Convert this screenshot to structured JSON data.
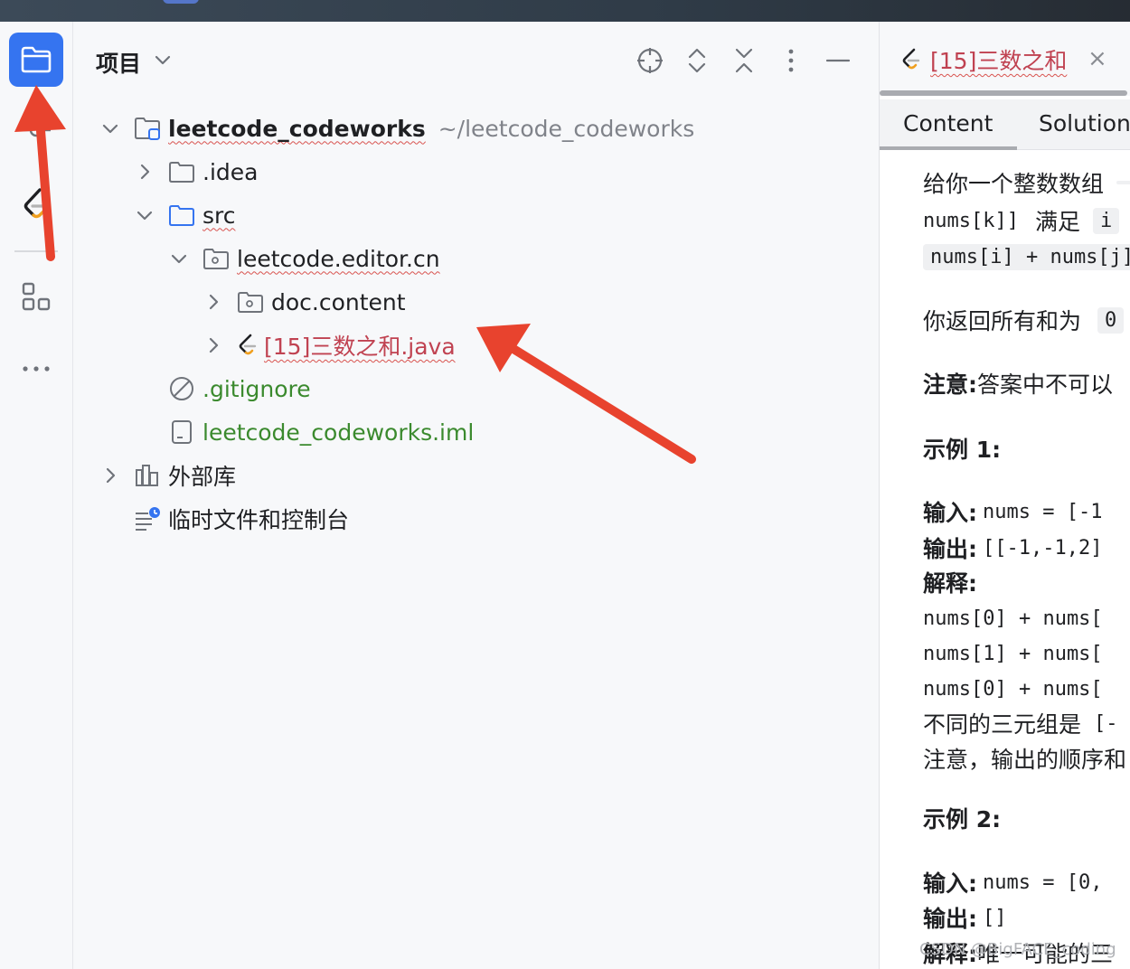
{
  "panel": {
    "title": "项目"
  },
  "tree": {
    "root_name": "leetcode_codeworks",
    "root_path": "~/leetcode_codeworks",
    "idea": ".idea",
    "src": "src",
    "package": "leetcode.editor.cn",
    "doc_content": "doc.content",
    "java_file": "[15]三数之和.java",
    "gitignore": ".gitignore",
    "iml": "leetcode_codeworks.iml",
    "external_libs": "外部库",
    "scratches": "临时文件和控制台"
  },
  "editor": {
    "tab_title": "[15]三数之和",
    "close_glyph": "×",
    "subtab_content": "Content",
    "subtab_solution": "Solution",
    "lines": {
      "l1": "给你一个整数数组",
      "l2_code": "nums[k]]",
      "l2_text": "满足",
      "l2_code2": "i",
      "l3_code": "nums[i] + nums[j]",
      "l4_text": "你返回所有和为",
      "l4_code": "0",
      "l5_bold": "注意:",
      "l5_text": "答案中不可以",
      "l6_bold": "示例 1:",
      "l7_bold": "输入:",
      "l7_code": "nums = [-1",
      "l8_bold": "输出:",
      "l8_code": "[[-1,-1,2]",
      "l9_bold": "解释:",
      "l10_code": "nums[0] + nums[",
      "l11_code": "nums[1] + nums[",
      "l12_code": "nums[0] + nums[",
      "l13_text": "不同的三元组是",
      "l13_code": "[-",
      "l14_text": "注意，输出的顺序和",
      "l15_bold": "示例 2:",
      "l16_bold": "输入:",
      "l16_code": "nums = [0,",
      "l17_bold": "输出:",
      "l17_code": "[]",
      "l18_bold": "解释:",
      "l18_text": "唯一可能的三"
    },
    "watermark": "CSDN @BigFACE_coding"
  },
  "colors": {
    "accent": "#3574f0",
    "arrow": "#e8432e",
    "error_text": "#c04251",
    "ignored_text": "#3b8a2e"
  }
}
